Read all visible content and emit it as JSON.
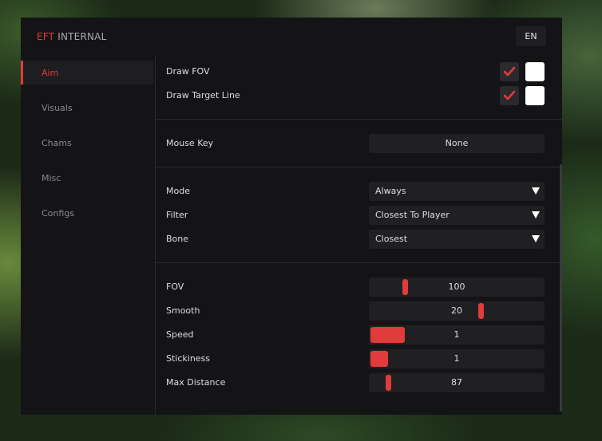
{
  "app": {
    "brand_accent": "EFT",
    "brand_rest": "INTERNAL",
    "language": "EN",
    "accent_color": "#e13b3b"
  },
  "sidebar": {
    "items": [
      {
        "label": "Aim",
        "active": true
      },
      {
        "label": "Visuals",
        "active": false
      },
      {
        "label": "Chams",
        "active": false
      },
      {
        "label": "Misc",
        "active": false
      },
      {
        "label": "Configs",
        "active": false
      }
    ]
  },
  "aim": {
    "toggles": [
      {
        "label": "Draw FOV",
        "checked": true,
        "color": "#ffffff"
      },
      {
        "label": "Draw Target Line",
        "checked": true,
        "color": "#ffffff"
      }
    ],
    "mouse_key": {
      "label": "Mouse Key",
      "value": "None"
    },
    "selects": [
      {
        "label": "Mode",
        "value": "Always"
      },
      {
        "label": "Filter",
        "value": "Closest To Player"
      },
      {
        "label": "Bone",
        "value": "Closest"
      }
    ],
    "sliders": [
      {
        "label": "FOV",
        "value": "100",
        "style": "knob",
        "level": 0.2
      },
      {
        "label": "Smooth",
        "value": "20",
        "style": "knob",
        "level": 0.64
      },
      {
        "label": "Speed",
        "value": "1",
        "style": "fill",
        "level": 0.2
      },
      {
        "label": "Stickiness",
        "value": "1",
        "style": "fill",
        "level": 0.1
      },
      {
        "label": "Max Distance",
        "value": "87",
        "style": "knob",
        "level": 0.1
      }
    ]
  }
}
